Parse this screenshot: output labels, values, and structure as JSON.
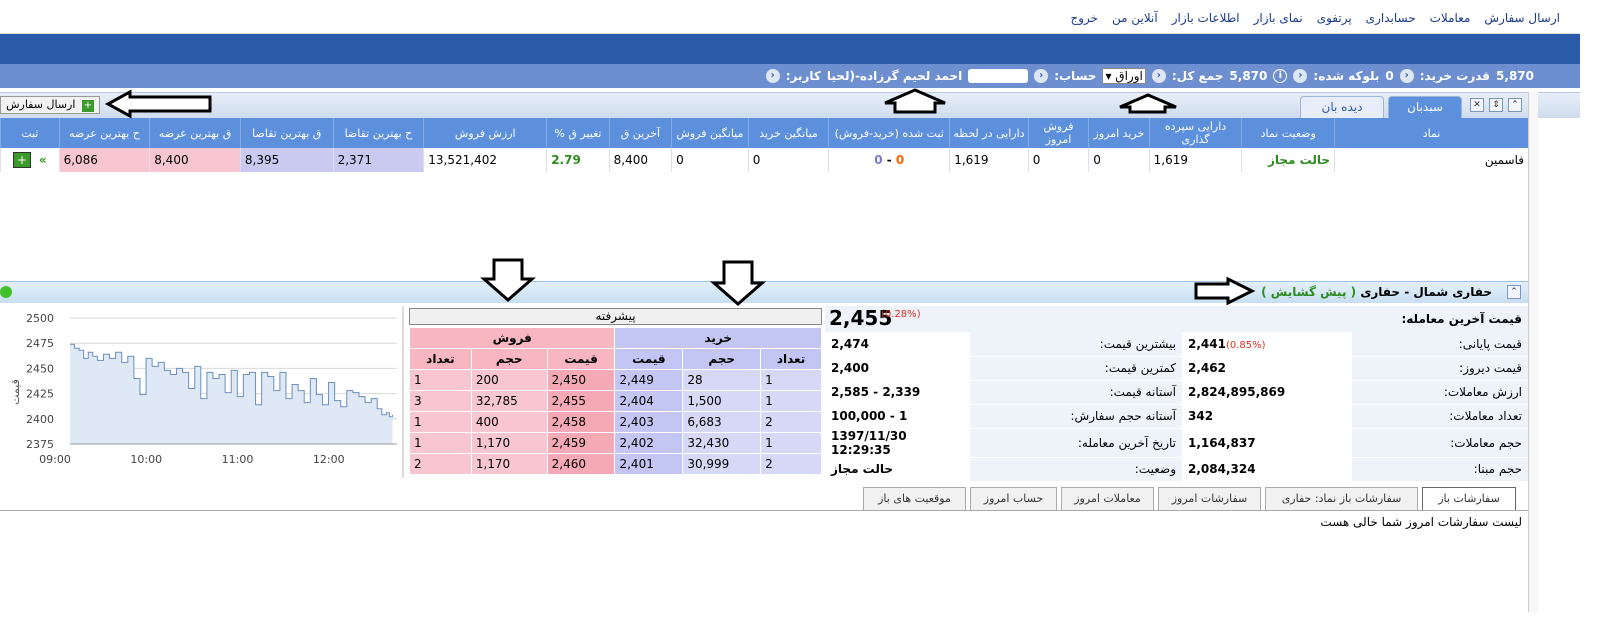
{
  "top_menu": [
    "ارسال سفارش",
    "معاملات",
    "حسابداری",
    "پرتفوی",
    "نمای بازار",
    "اطلاعات بازار",
    "آنلاین من",
    "خروج"
  ],
  "info": {
    "user_label": "کاربر:",
    "user_name": "احمد لحیم گرزاده-(لحیا",
    "account_label": "حساب:",
    "account_value": "اوراق",
    "total_label": "جمع کل:",
    "total_value": "5,870",
    "info_icon": "i",
    "blocked_label": "بلوکه شده:",
    "blocked_value": "0",
    "power_label": "قدرت خرید:",
    "power_value": "5,870"
  },
  "watch_tabs": {
    "basket": "سبدبان",
    "watch": "دیده بان"
  },
  "send_order_button": "ارسال سفارش",
  "watch_table": {
    "headers": [
      "نماد",
      "وضعیت نماد",
      "دارایی سپرده گذاری",
      "خرید امروز",
      "فروش امروز",
      "دارایی در لحظه",
      "ثبت شده (خرید-فروش)",
      "میانگین خرید",
      "میانگین فروش",
      "آخرین ق",
      "تغییر ق %",
      "ارزش فروش",
      "ح بهترین تقاضا",
      "ق بهترین تقاضا",
      "ق بهترین عرضه",
      "ح بهترین عرضه",
      "ثبت"
    ],
    "row": {
      "symbol": "فاسمین",
      "status": "حالت مجاز",
      "deposit": "1,619",
      "buy_today": "0",
      "sell_today": "0",
      "current": "1,619",
      "registered_buy": "0",
      "registered_sep": " - ",
      "registered_sell": "0",
      "avg_buy": "0",
      "avg_sell": "0",
      "last_price": "8,400",
      "change_pct": "2.79",
      "sell_value": "13,521,402",
      "bid_vol": "2,371",
      "bid_price": "8,395",
      "ask_price": "8,400",
      "ask_vol": "6,086"
    }
  },
  "section": {
    "title": "حفاری شمال - حفاری",
    "status": "( پیش گشایش )"
  },
  "chart_data": {
    "type": "line",
    "ylabel": "قیمت",
    "ylim": [
      2375,
      2500
    ],
    "yticks": [
      "2500",
      "2475",
      "2450",
      "2425",
      "2400",
      "2375"
    ],
    "xticks": [
      "09:00",
      "10:00",
      "11:00",
      "12:00"
    ],
    "x_minutes": [
      0,
      3,
      6,
      9,
      12,
      15,
      18,
      22,
      26,
      30,
      34,
      38,
      42,
      46,
      50,
      54,
      58,
      62,
      66,
      70,
      74,
      78,
      82,
      86,
      90,
      94,
      98,
      102,
      106,
      110,
      114,
      118,
      122,
      126,
      130,
      134,
      138,
      142,
      146,
      150,
      154,
      158,
      162,
      166,
      170,
      174,
      178,
      182,
      186,
      190,
      194,
      198,
      202,
      205,
      208,
      210,
      212
    ],
    "values": [
      2474,
      2470,
      2468,
      2460,
      2466,
      2462,
      2458,
      2464,
      2460,
      2466,
      2456,
      2462,
      2440,
      2424,
      2460,
      2452,
      2456,
      2448,
      2444,
      2450,
      2446,
      2430,
      2452,
      2420,
      2446,
      2440,
      2444,
      2426,
      2448,
      2422,
      2444,
      2446,
      2414,
      2446,
      2442,
      2428,
      2446,
      2420,
      2434,
      2428,
      2416,
      2440,
      2424,
      2414,
      2436,
      2418,
      2412,
      2428,
      2426,
      2422,
      2416,
      2420,
      2410,
      2404,
      2406,
      2402,
      2404
    ],
    "x_range_minutes": [
      0,
      215
    ]
  },
  "orderbook": {
    "advanced_button": "پیشرفته",
    "buy_title": "خرید",
    "sell_title": "فروش",
    "buy_headers": [
      "تعداد",
      "حجم",
      "قیمت"
    ],
    "sell_headers": [
      "قیمت",
      "حجم",
      "تعداد"
    ],
    "rows": [
      {
        "buy_count": "1",
        "buy_vol": "28",
        "buy_price": "2,449",
        "sell_price": "2,450",
        "sell_vol": "200",
        "sell_count": "1"
      },
      {
        "buy_count": "1",
        "buy_vol": "1,500",
        "buy_price": "2,404",
        "sell_price": "2,455",
        "sell_vol": "32,785",
        "sell_count": "3"
      },
      {
        "buy_count": "2",
        "buy_vol": "6,683",
        "buy_price": "2,403",
        "sell_price": "2,458",
        "sell_vol": "400",
        "sell_count": "1"
      },
      {
        "buy_count": "1",
        "buy_vol": "32,430",
        "buy_price": "2,402",
        "sell_price": "2,459",
        "sell_vol": "1,170",
        "sell_count": "1"
      },
      {
        "buy_count": "2",
        "buy_vol": "30,999",
        "buy_price": "2,401",
        "sell_price": "2,460",
        "sell_vol": "1,170",
        "sell_count": "2"
      }
    ]
  },
  "details": {
    "last_trade_label": "قیمت آخرین معامله:",
    "last_trade_value": "2,455",
    "last_trade_pct": "(0.28%)",
    "left": [
      {
        "label": "قیمت پایانی:",
        "value": "2,441",
        "extra": "(0.85%)"
      },
      {
        "label": "قیمت دیروز:",
        "value": "2,462"
      },
      {
        "label": "ارزش معاملات:",
        "value": "2,824,895,869"
      },
      {
        "label": "تعداد معاملات:",
        "value": "342"
      },
      {
        "label": "حجم معاملات:",
        "value": "1,164,837"
      },
      {
        "label": "حجم مبنا:",
        "value": "2,084,324"
      }
    ],
    "right": [
      {
        "label": "بیشترین قیمت:",
        "value": "2,474"
      },
      {
        "label": "کمترین قیمت:",
        "value": "2,400"
      },
      {
        "label": "آستانه قیمت:",
        "value": "2,339 - 2,585"
      },
      {
        "label": "آستانه حجم سفارش:",
        "value": "1 - 100,000"
      },
      {
        "label": "تاریخ آخرین معامله:",
        "value": "1397/11/30 12:29:35"
      },
      {
        "label": "وضعیت:",
        "value": "حالت مجاز"
      }
    ]
  },
  "bottom_tabs": [
    "سفارشات باز",
    "سفارشات باز نماد: حفاری",
    "سفارشات امروز",
    "معاملات امروز",
    "حساب امروز",
    "موقعیت های باز"
  ],
  "empty_message": "لیست سفارشات امروز شما خالی هست",
  "colors": {
    "header_blue": "#2b5aaa",
    "table_header": "#5c8fdc",
    "buy_bg": "#c9c9f2",
    "sell_bg": "#f7b6c0",
    "green": "#2e8b1f",
    "orange": "#ff6600"
  }
}
